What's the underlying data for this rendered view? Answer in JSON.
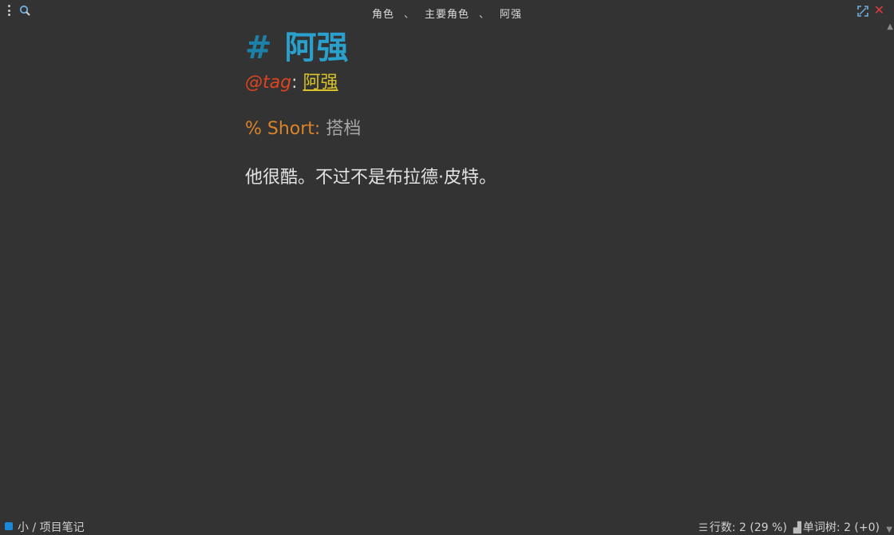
{
  "breadcrumb": {
    "items": [
      "角色",
      "主要角色",
      "阿强"
    ],
    "separator": "、"
  },
  "document": {
    "heading_marker": "#",
    "heading": "阿强",
    "tag_key": "@tag",
    "tag_colon": ":",
    "tag_value": "阿强",
    "short_key": "% Short:",
    "short_value": "搭档",
    "body": "他很酷。不过不是布拉德·皮特。"
  },
  "statusbar": {
    "project": "小 / 项目笔记",
    "lines_label": "行数: 2 (29 %)",
    "words_label": "单词树: 2 (+0)"
  },
  "icons": {
    "menu": "vertical-dots-icon",
    "search": "search-icon",
    "fullscreen": "fullscreen-icon",
    "close": "close-icon",
    "lines": "list-icon",
    "words": "bar-chart-icon"
  },
  "colors": {
    "background": "#333333",
    "heading": "#2aa0cc",
    "tag_key": "#dd4422",
    "tag_value": "#d9c32a",
    "short_key": "#d9832a",
    "close": "#e03a3a",
    "project": "#1e88d8"
  }
}
